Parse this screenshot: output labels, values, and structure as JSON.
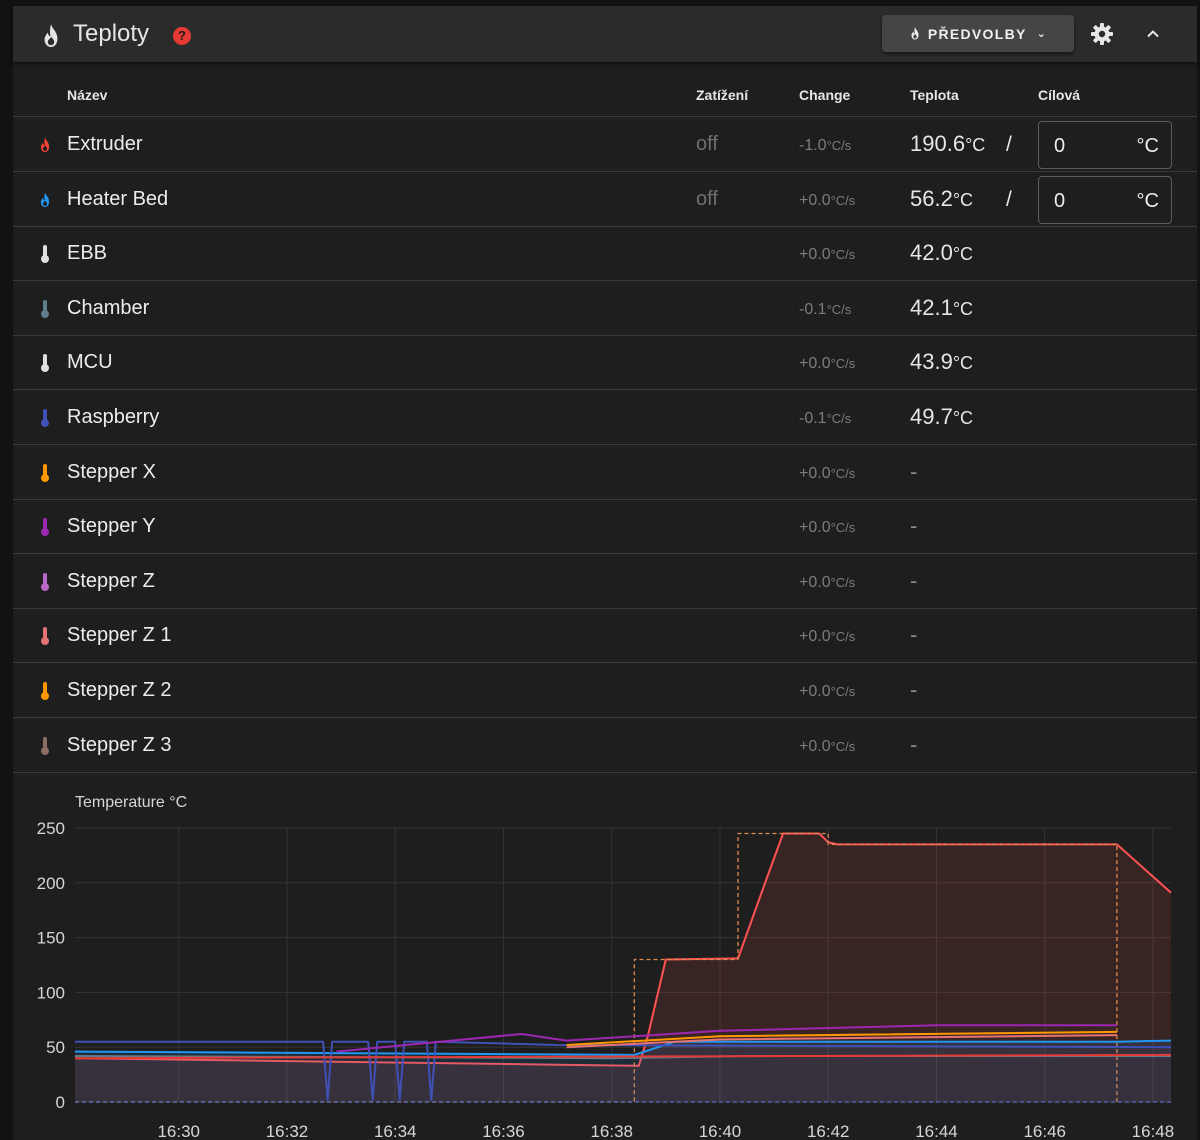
{
  "panel": {
    "title": "Teploty",
    "help_icon": "question-circle-icon",
    "presets_label": "PŘEDVOLBY",
    "colors": {
      "accent_fire": "#e0533c",
      "help_red": "#e53935",
      "button_bg": "#454545"
    }
  },
  "table": {
    "headers": {
      "name": "Název",
      "load": "Zatížení",
      "change": "Change",
      "temp": "Teplota",
      "target": "Cílová"
    },
    "rows": [
      {
        "name": "Extruder",
        "icon": "fire-icon",
        "color": "#f44336",
        "load": "off",
        "change_val": "-1.0",
        "change_unit": "°C/s",
        "temp_val": "190.6",
        "temp_unit": "°C",
        "slash": "/",
        "target": "0",
        "target_unit": "°C"
      },
      {
        "name": "Heater Bed",
        "icon": "fire-icon",
        "color": "#2196f3",
        "load": "off",
        "change_val": "+0.0",
        "change_unit": "°C/s",
        "temp_val": "56.2",
        "temp_unit": "°C",
        "slash": "/",
        "target": "0",
        "target_unit": "°C"
      },
      {
        "name": "EBB",
        "icon": "thermometer-icon",
        "color": "#e0e0e0",
        "change_val": "+0.0",
        "change_unit": "°C/s",
        "temp_val": "42.0",
        "temp_unit": "°C"
      },
      {
        "name": "Chamber",
        "icon": "thermometer-icon",
        "color": "#607d8b",
        "change_val": "-0.1",
        "change_unit": "°C/s",
        "temp_val": "42.1",
        "temp_unit": "°C"
      },
      {
        "name": "MCU",
        "icon": "thermometer-icon",
        "color": "#e0e0e0",
        "change_val": "+0.0",
        "change_unit": "°C/s",
        "temp_val": "43.9",
        "temp_unit": "°C"
      },
      {
        "name": "Raspberry",
        "icon": "thermometer-icon",
        "color": "#3f51b5",
        "change_val": "-0.1",
        "change_unit": "°C/s",
        "temp_val": "49.7",
        "temp_unit": "°C"
      },
      {
        "name": "Stepper X",
        "icon": "thermometer-icon",
        "color": "#ff9800",
        "change_val": "+0.0",
        "change_unit": "°C/s",
        "temp_val": "-",
        "temp_unit": ""
      },
      {
        "name": "Stepper Y",
        "icon": "thermometer-icon",
        "color": "#9c27b0",
        "change_val": "+0.0",
        "change_unit": "°C/s",
        "temp_val": "-",
        "temp_unit": ""
      },
      {
        "name": "Stepper Z",
        "icon": "thermometer-icon",
        "color": "#ba68c8",
        "change_val": "+0.0",
        "change_unit": "°C/s",
        "temp_val": "-",
        "temp_unit": ""
      },
      {
        "name": "Stepper Z 1",
        "icon": "thermometer-icon",
        "color": "#e57373",
        "change_val": "+0.0",
        "change_unit": "°C/s",
        "temp_val": "-",
        "temp_unit": ""
      },
      {
        "name": "Stepper Z 2",
        "icon": "thermometer-icon",
        "color": "#ff9800",
        "change_val": "+0.0",
        "change_unit": "°C/s",
        "temp_val": "-",
        "temp_unit": ""
      },
      {
        "name": "Stepper Z 3",
        "icon": "thermometer-icon",
        "color": "#8d6e63",
        "change_val": "+0.0",
        "change_unit": "°C/s",
        "temp_val": "-",
        "temp_unit": ""
      }
    ]
  },
  "chart_data": {
    "type": "line",
    "title": "Temperature °C",
    "xlabel": "",
    "ylabel": "",
    "x_ticks": [
      "16:30",
      "16:32",
      "16:34",
      "16:36",
      "16:38",
      "16:40",
      "16:42",
      "16:44",
      "16:46",
      "16:48"
    ],
    "x_range": [
      "16:28:05",
      "16:48:20"
    ],
    "ylim": [
      0,
      250
    ],
    "y_ticks": [
      0,
      50,
      100,
      150,
      200,
      250
    ],
    "grid": true,
    "series": [
      {
        "color": "#ff5252",
        "area": true,
        "x": [
          "16:28:05",
          "16:37:00",
          "16:38:30",
          "16:38:40",
          "16:39:00",
          "16:40:20",
          "16:40:50",
          "16:41:10",
          "16:41:50",
          "16:42:00",
          "16:42:10",
          "16:47:20",
          "16:48:20"
        ],
        "values": [
          40,
          34,
          33,
          60,
          130,
          131,
          200,
          245,
          245,
          237,
          235,
          235,
          191
        ]
      },
      {
        "color": "#e08a4f",
        "dashed": true,
        "x": [
          "16:28:05",
          "16:38:25",
          "16:38:25",
          "16:40:20",
          "16:40:20",
          "16:42:00",
          "16:42:00",
          "16:47:20",
          "16:47:20"
        ],
        "values": [
          0,
          0,
          130,
          130,
          245,
          245,
          235,
          235,
          0
        ]
      },
      {
        "color": "#2196f3",
        "area": true,
        "x": [
          "16:28:05",
          "16:38:25",
          "16:39:10",
          "16:47:20",
          "16:48:20"
        ],
        "values": [
          46,
          43,
          55,
          55,
          56
        ]
      },
      {
        "color": "#5c6bc0",
        "dashed": true,
        "x": [
          "16:28:05",
          "16:48:20"
        ],
        "values": [
          0,
          0
        ]
      },
      {
        "color": "#3f51b5",
        "x": [
          "16:28:05",
          "16:32:40",
          "16:32:45",
          "16:32:50",
          "16:33:30",
          "16:33:35",
          "16:33:40",
          "16:34:00",
          "16:34:05",
          "16:34:10",
          "16:34:35",
          "16:34:40",
          "16:34:45",
          "16:37:00",
          "16:48:20"
        ],
        "values": [
          55,
          55,
          2,
          55,
          55,
          2,
          55,
          55,
          2,
          55,
          55,
          2,
          55,
          52,
          50
        ]
      },
      {
        "color": "#9c27b0",
        "x": [
          "16:32:55",
          "16:36:20",
          "16:37:10",
          "16:40:00",
          "16:44:00",
          "16:47:20"
        ],
        "values": [
          46,
          62,
          56,
          65,
          70,
          70
        ]
      },
      {
        "color": "#ff9800",
        "x": [
          "16:37:10",
          "16:40:00",
          "16:47:20"
        ],
        "values": [
          52,
          60,
          64
        ]
      },
      {
        "color": "#e57373",
        "x": [
          "16:37:10",
          "16:40:00",
          "16:47:20"
        ],
        "values": [
          50,
          57,
          61
        ]
      },
      {
        "color": "#607d8b",
        "x": [
          "16:28:05",
          "16:38:00",
          "16:40:30",
          "16:48:20"
        ],
        "values": [
          42,
          40,
          42,
          42
        ]
      },
      {
        "color": "#e53935",
        "x": [
          "16:28:05",
          "16:48:20"
        ],
        "values": [
          40,
          43
        ]
      }
    ]
  }
}
